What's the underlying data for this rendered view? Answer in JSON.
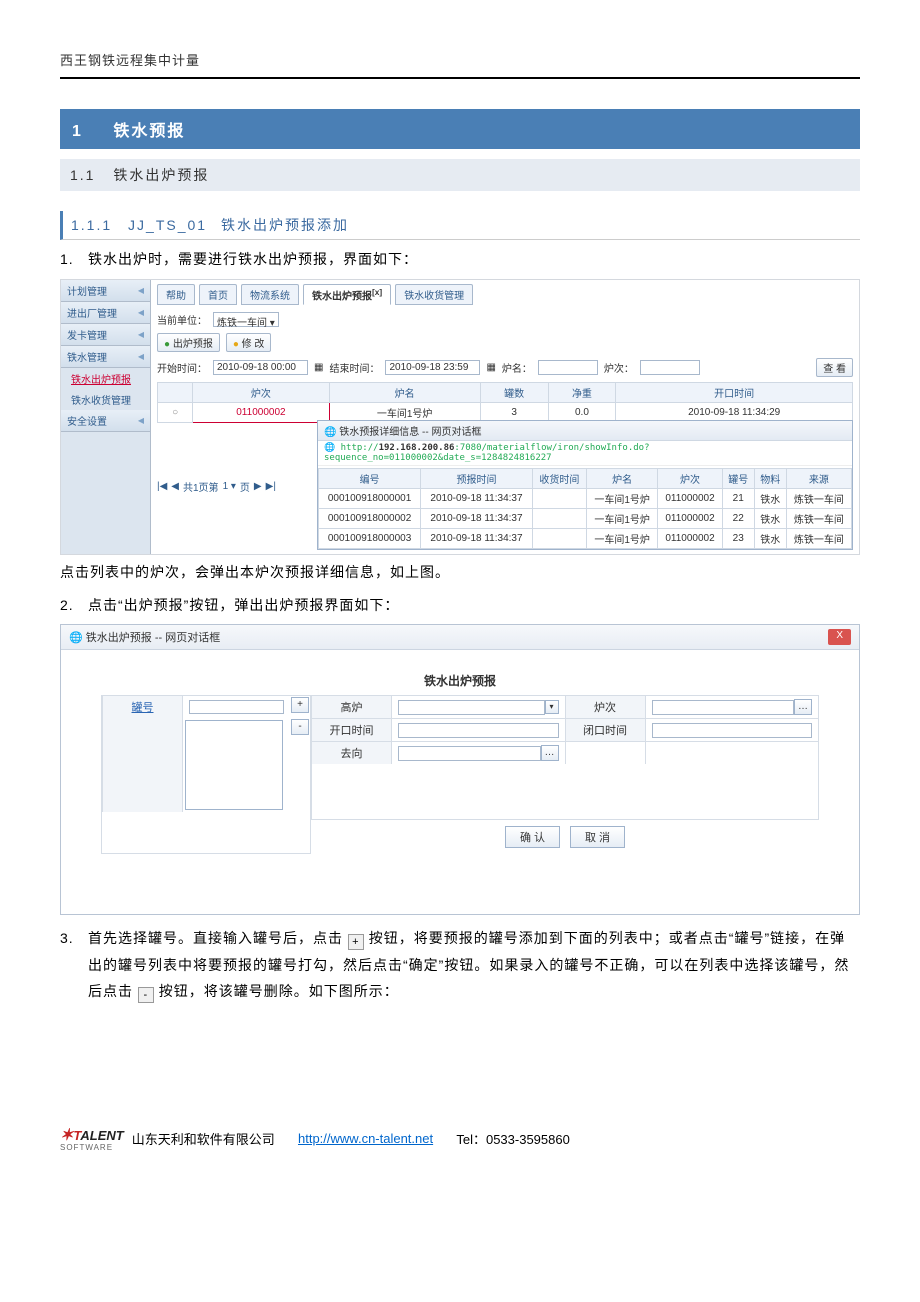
{
  "page_header": "西王钢铁远程集中计量",
  "h1": {
    "num": "1",
    "title": "铁水预报"
  },
  "h2": {
    "num": "1.1",
    "title": "铁水出炉预报"
  },
  "h3": {
    "num": "1.1.1",
    "code": "JJ_TS_01",
    "title": "铁水出炉预报添加"
  },
  "p1_num": "1.",
  "p1": "铁水出炉时，需要进行铁水出炉预报，界面如下：",
  "p_click": "点击列表中的炉次，会弹出本炉次预报详细信息，如上图。",
  "p2_num": "2.",
  "p2": "点击“出炉预报”按钮，弹出出炉预报界面如下：",
  "p3_num": "3.",
  "p3a": "首先选择罐号。直接输入罐号后，点击",
  "p3b": "按钮，将要预报的罐号添加到下面的列表中；或者点击“罐号”链接，在弹出的罐号列表中将要预报的罐号打勾，然后点击“确定”按钮。如果录入的罐号不正确，可以在列表中选择该罐号，然后点击",
  "p3c": "按钮，将该罐号删除。如下图所示：",
  "plus": "+",
  "minus": "-",
  "shot1": {
    "sidebar": [
      {
        "label": "计划管理",
        "type": "head"
      },
      {
        "label": "进出厂管理",
        "type": "head"
      },
      {
        "label": "发卡管理",
        "type": "head"
      },
      {
        "label": "铁水管理",
        "type": "head"
      },
      {
        "label": "铁水出炉预报",
        "type": "sub",
        "sel": true
      },
      {
        "label": "铁水收货管理",
        "type": "sub"
      },
      {
        "label": "安全设置",
        "type": "head"
      }
    ],
    "tabs": [
      "帮助",
      "首页",
      "物流系统",
      "铁水出炉预报",
      "铁水收货管理"
    ],
    "active_tab_idx": 3,
    "unit_label": "当前单位：",
    "unit_value": "炼铁一车间",
    "btn_report": "出炉预报",
    "btn_modify": "修 改",
    "start_label": "开始时间：",
    "start_val": "2010-09-18 00:00",
    "end_label": "结束时间：",
    "end_val": "2010-09-18 23:59",
    "ln_label": "炉名：",
    "lc_label": "炉次：",
    "query_btn": "查 看",
    "table_headers": [
      "",
      "炉次",
      "炉名",
      "罐数",
      "净重",
      "开口时间"
    ],
    "table_row": [
      "",
      "011000002",
      "一车间1号炉",
      "3",
      "0.0",
      "2010-09-18 11:34:29"
    ],
    "pager": "共1页第",
    "pager2": "页",
    "popup_title": "铁水预报详细信息 -- 网页对话框",
    "popup_url_prefix": "http://",
    "popup_url_host": "192.168.200.86",
    "popup_url_rest": ":7080/materialflow/iron/showInfo.do?sequence_no=011000002&date_s=1284824816227",
    "popup_headers": [
      "编号",
      "预报时间",
      "收货时间",
      "炉名",
      "炉次",
      "罐号",
      "物料",
      "来源"
    ],
    "popup_rows": [
      [
        "000100918000001",
        "2010-09-18 11:34:37",
        "",
        "一车间1号炉",
        "011000002",
        "21",
        "铁水",
        "炼铁一车间"
      ],
      [
        "000100918000002",
        "2010-09-18 11:34:37",
        "",
        "一车间1号炉",
        "011000002",
        "22",
        "铁水",
        "炼铁一车间"
      ],
      [
        "000100918000003",
        "2010-09-18 11:34:37",
        "",
        "一车间1号炉",
        "011000002",
        "23",
        "铁水",
        "炼铁一车间"
      ]
    ]
  },
  "shot2": {
    "win_title": "铁水出炉预报 -- 网页对话框",
    "close": "X",
    "form_title": "铁水出炉预报",
    "l_guan": "罐号",
    "l_gaolu": "高炉",
    "l_luci": "炉次",
    "l_kaikou": "开口时间",
    "l_bikou": "闭口时间",
    "l_quxiang": "去向",
    "btn_ok": "确 认",
    "btn_cancel": "取 消"
  },
  "footer": {
    "logo1": "T",
    "logo2": "ALENT",
    "logo_sub": "SOFTWARE",
    "company": "  山东天利和软件有限公司",
    "link": "http://www.cn-talent.net",
    "tel": "Tel：0533-3595860"
  }
}
